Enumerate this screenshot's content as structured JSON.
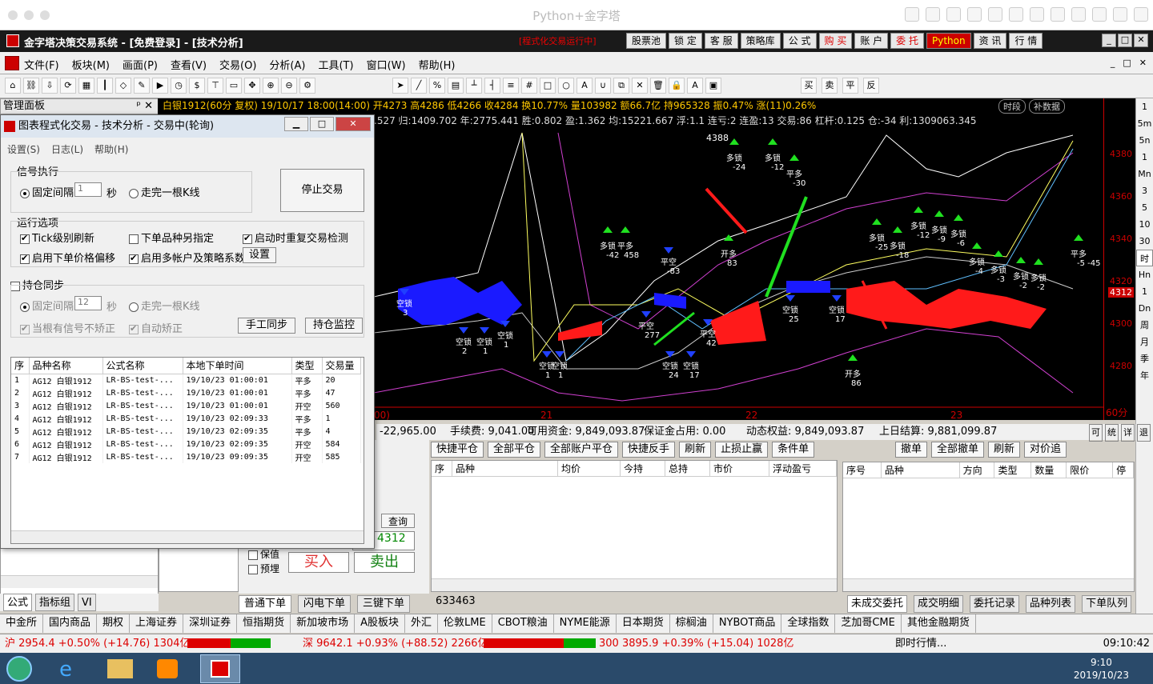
{
  "window": {
    "title": "Python+金字塔"
  },
  "app": {
    "title": "金字塔决策交易系统 - [免费登录] - [技术分析]",
    "mode_text": "[程式化交易运行中]",
    "top_buttons": [
      "股票池",
      "锁 定",
      "客 服",
      "策略库",
      "公 式",
      "购 买",
      "账 户",
      "委 托",
      "Python",
      "资 讯",
      "行 情"
    ]
  },
  "menu": [
    "文件(F)",
    "板块(M)",
    "画面(P)",
    "查看(V)",
    "交易(O)",
    "分析(A)",
    "工具(T)",
    "窗口(W)",
    "帮助(H)"
  ],
  "panel": {
    "title": "管理面板",
    "tabs": [
      "公式",
      "指标组",
      "VI"
    ]
  },
  "chart": {
    "header1": "白银1912(60分 复权) 19/10/17 18:00(14:00) 开4273 高4286 低4266 收4284 换10.77% 量103982 额66.7亿 持965328 振0.47% 涨(11)0.26%",
    "header1_buttons": [
      "时段",
      "补数据"
    ],
    "header2": ".527 归:1409.702 年:2775.441 胜:0.802 盈:1.362 均:15221.667 浮:1.1 连亏:2 连盈:13 交易:86 杠杆:0.125 仓:-34 利:1309063.345",
    "y_ticks": [
      "4380",
      "4360",
      "4340",
      "4320",
      "4300",
      "4280"
    ],
    "price_tag": "4312",
    "peak_label": "4388",
    "x_labels": [
      "00)",
      "21",
      "22",
      "23",
      "60分"
    ],
    "period": "60分",
    "annotations": [
      {
        "t": "空锁",
        "n": "3"
      },
      {
        "t": "空锁",
        "n": "2"
      },
      {
        "t": "空锁",
        "n": "1"
      },
      {
        "t": "空锁",
        "n": "1"
      },
      {
        "t": "空锁",
        "n": "1"
      },
      {
        "t": "空锁",
        "n": "1"
      },
      {
        "t": "多锁",
        "n": "-42"
      },
      {
        "t": "平多",
        "n": "458"
      },
      {
        "t": "平空",
        "n": "-83"
      },
      {
        "t": "平空",
        "n": "277"
      },
      {
        "t": "开多",
        "n": "83"
      },
      {
        "t": "多锁",
        "n": "-24"
      },
      {
        "t": "多锁",
        "n": "-12"
      },
      {
        "t": "平多",
        "n": "-30"
      },
      {
        "t": "空锁",
        "n": "24"
      },
      {
        "t": "空锁",
        "n": "17"
      },
      {
        "t": "平空",
        "n": "42"
      },
      {
        "t": "空锁",
        "n": "25"
      },
      {
        "t": "空锁",
        "n": "17"
      },
      {
        "t": "开多",
        "n": "86"
      },
      {
        "t": "多锁",
        "n": "-25"
      },
      {
        "t": "多锁",
        "n": "-18"
      },
      {
        "t": "多锁",
        "n": "-12"
      },
      {
        "t": "多锁",
        "n": "-9"
      },
      {
        "t": "多锁",
        "n": "-6"
      },
      {
        "t": "多锁",
        "n": "-4"
      },
      {
        "t": "多锁",
        "n": "-3"
      },
      {
        "t": "多锁",
        "n": "-2"
      },
      {
        "t": "多锁",
        "n": "-2"
      },
      {
        "t": "平多",
        "n": "-5 -45"
      }
    ],
    "period_buttons": [
      "1",
      "5m",
      "5n",
      "1",
      "Mn",
      "3",
      "5",
      "10",
      "30",
      "时",
      "Hn",
      "1",
      "Dn",
      "周",
      "月",
      "季",
      "年"
    ]
  },
  "account": {
    "items": [
      "-22,965.00",
      "手续费: 9,041.00",
      "可用资金: 9,849,093.87",
      "保证金占用: 0.00",
      "动态权益: 9,849,093.87",
      "上日结算: 9,881,099.87"
    ],
    "end_buttons": [
      "可",
      "统",
      "详",
      "退"
    ]
  },
  "trade_buttons": [
    "快捷平仓",
    "全部平仓",
    "全部账户平仓",
    "快捷反手",
    "刷新",
    "止损止赢",
    "条件单"
  ],
  "order_buttons": [
    "撤单",
    "全部撤单",
    "刷新",
    "对价追"
  ],
  "position_cols": [
    "序",
    "品种",
    "均价",
    "今持",
    "总持",
    "市价",
    "浮动盈亏"
  ],
  "order_cols": [
    "序号",
    "品种",
    "方向",
    "类型",
    "数量",
    "限价",
    "停"
  ],
  "order_panel": {
    "price": "4312",
    "buy": "买入",
    "sell": "卖出",
    "query": "查询",
    "opt1": "保值",
    "opt2": "预埋",
    "tabs": [
      "普通下单",
      "闪电下单",
      "三键下单"
    ]
  },
  "bottom_tabs": [
    "未成交委托",
    "成交明细",
    "委托记录",
    "品种列表",
    "下单队列"
  ],
  "footer_num": "633463",
  "markets": [
    "中金所",
    "国内商品",
    "期权",
    "上海证券",
    "深圳证券",
    "恒指期货",
    "新加坡市场",
    "A股板块",
    "外汇",
    "伦敦LME",
    "CBOT粮油",
    "NYME能源",
    "日本期货",
    "棕榈油",
    "NYBOT商品",
    "全球指数",
    "芝加哥CME",
    "其他金融期货"
  ],
  "index": {
    "sh": "沪 2954.4 +0.50% (+14.76) 1304亿",
    "sz": "深 9642.1 +0.93% (+88.52) 2266亿",
    "s300": "300 3895.9 +0.39% (+15.04) 1028亿",
    "news": "即时行情...",
    "time": "09:10:42"
  },
  "taskbar": {
    "time": "9:10",
    "date": "2019/10/23"
  },
  "dialog": {
    "title": "图表程式化交易 - 技术分析 - 交易中(轮询)",
    "menu": [
      "设置(S)",
      "日志(L)",
      "帮助(H)"
    ],
    "signal_group": "信号执行",
    "fixed_interval": "固定间隔",
    "interval_value": "1",
    "sec": "秒",
    "per_kline": "走完一根K线",
    "stop_button": "停止交易",
    "run_group": "运行选项",
    "opts": [
      "Tick级别刷新",
      "下单品种另指定",
      "启动时重复交易检测",
      "启用下单价格偏移",
      "启用多帐户及策略系数"
    ],
    "set_button": "设置",
    "sync": "持仓同步",
    "sync_interval": "12",
    "no_correct": "当根有信号不矫正",
    "auto_correct": "自动矫正",
    "manual_sync": "手工同步",
    "monitor": "持仓监控",
    "cols": [
      "序",
      "品种名称",
      "公式名称",
      "本地下单时间",
      "类型",
      "交易量"
    ],
    "rows": [
      [
        "1",
        "AG12 白银1912",
        "LR-BS-test-...",
        "19/10/23 01:00:01",
        "平多",
        "20"
      ],
      [
        "2",
        "AG12 白银1912",
        "LR-BS-test-...",
        "19/10/23 01:00:01",
        "平多",
        "47"
      ],
      [
        "3",
        "AG12 白银1912",
        "LR-BS-test-...",
        "19/10/23 01:00:01",
        "开空",
        "560"
      ],
      [
        "4",
        "AG12 白银1912",
        "LR-BS-test-...",
        "19/10/23 02:09:33",
        "平多",
        "1"
      ],
      [
        "5",
        "AG12 白银1912",
        "LR-BS-test-...",
        "19/10/23 02:09:35",
        "平多",
        "4"
      ],
      [
        "6",
        "AG12 白银1912",
        "LR-BS-test-...",
        "19/10/23 02:09:35",
        "开空",
        "584"
      ],
      [
        "7",
        "AG12 白银1912",
        "LR-BS-test-...",
        "19/10/23 09:09:35",
        "开空",
        "585"
      ]
    ]
  }
}
